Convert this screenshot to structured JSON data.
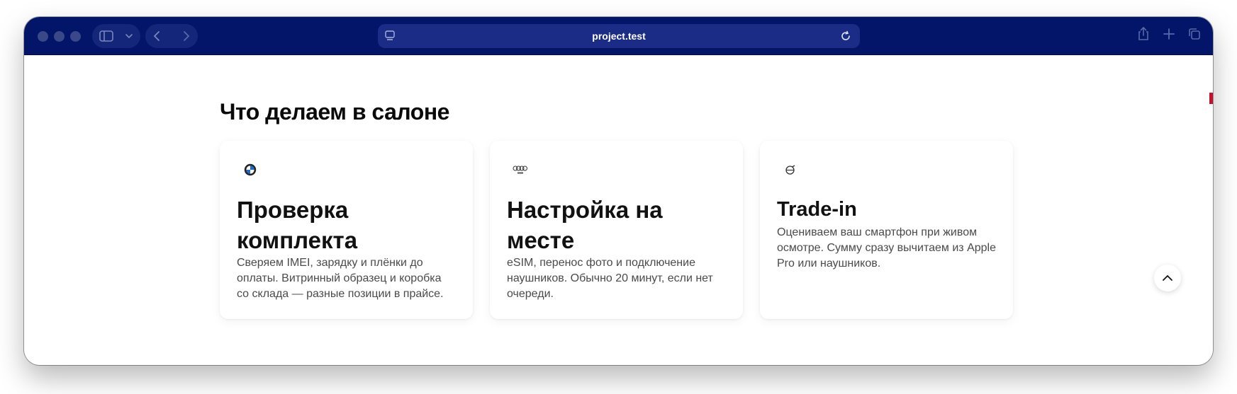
{
  "browser": {
    "url": "project.test"
  },
  "page": {
    "heading": "Что делаем в салоне",
    "cards": [
      {
        "icon": "bmw-logo-icon",
        "title": "Проверка комплекта",
        "description": "Сверяем IMEI, зарядку и плёнки до оплаты. Витринный образец и коробка со склада — разные позиции в прайсе."
      },
      {
        "icon": "audi-logo-icon",
        "title": "Настройка на месте",
        "description": "eSIM, перенос фото и подключение наушников. Обычно 20 минут, если нет очереди."
      },
      {
        "icon": "volvo-logo-icon",
        "title": "Trade-in",
        "description": "Оцениваем ваш смартфон при живом осмотре. Сумму сразу вычитаем из Apple Pro или наушников."
      }
    ]
  },
  "colors": {
    "toolbar": "#021568",
    "accent_tab": "#c8102e"
  }
}
